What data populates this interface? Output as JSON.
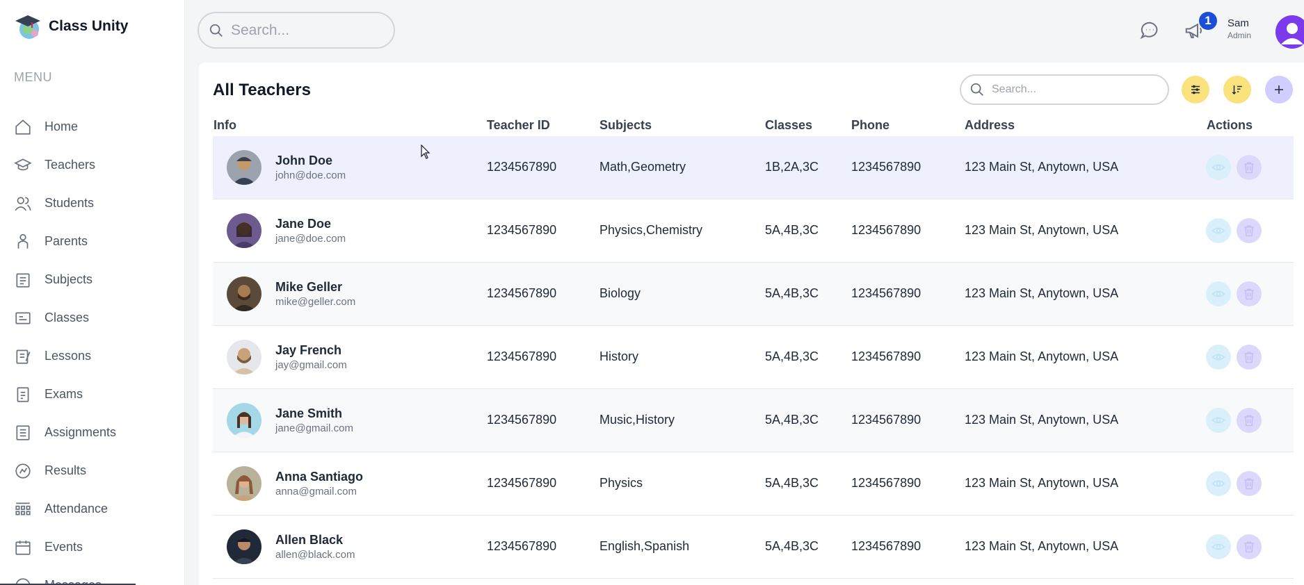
{
  "brand": {
    "name": "Class Unity"
  },
  "sidebar": {
    "menu_title": "MENU",
    "items": [
      {
        "label": "Home",
        "icon": "home-icon"
      },
      {
        "label": "Teachers",
        "icon": "teacher-icon"
      },
      {
        "label": "Students",
        "icon": "students-icon"
      },
      {
        "label": "Parents",
        "icon": "parents-icon"
      },
      {
        "label": "Subjects",
        "icon": "subjects-icon"
      },
      {
        "label": "Classes",
        "icon": "classes-icon"
      },
      {
        "label": "Lessons",
        "icon": "lessons-icon"
      },
      {
        "label": "Exams",
        "icon": "exams-icon"
      },
      {
        "label": "Assignments",
        "icon": "assignments-icon"
      },
      {
        "label": "Results",
        "icon": "results-icon"
      },
      {
        "label": "Attendance",
        "icon": "attendance-icon"
      },
      {
        "label": "Events",
        "icon": "events-icon"
      },
      {
        "label": "Messages",
        "icon": "messages-icon"
      }
    ]
  },
  "topbar": {
    "search_placeholder": "Search...",
    "notification_count": "1",
    "user_name": "Sam",
    "user_role": "Admin"
  },
  "page": {
    "title": "All Teachers",
    "search_placeholder": "Search..."
  },
  "colors": {
    "accent_yellow": "#fae27c",
    "accent_purple": "#cfceff",
    "row_highlight": "#eef0fd",
    "badge_blue": "#1d4ed8"
  },
  "table": {
    "headers": {
      "info": "Info",
      "teacher_id": "Teacher ID",
      "subjects": "Subjects",
      "classes": "Classes",
      "phone": "Phone",
      "address": "Address",
      "actions": "Actions"
    },
    "rows": [
      {
        "name": "John Doe",
        "email": "john@doe.com",
        "teacher_id": "1234567890",
        "subjects": "Math,Geometry",
        "classes": "1B,2A,3C",
        "phone": "1234567890",
        "address": "123 Main St, Anytown, USA"
      },
      {
        "name": "Jane Doe",
        "email": "jane@doe.com",
        "teacher_id": "1234567890",
        "subjects": "Physics,Chemistry",
        "classes": "5A,4B,3C",
        "phone": "1234567890",
        "address": "123 Main St, Anytown, USA"
      },
      {
        "name": "Mike Geller",
        "email": "mike@geller.com",
        "teacher_id": "1234567890",
        "subjects": "Biology",
        "classes": "5A,4B,3C",
        "phone": "1234567890",
        "address": "123 Main St, Anytown, USA"
      },
      {
        "name": "Jay French",
        "email": "jay@gmail.com",
        "teacher_id": "1234567890",
        "subjects": "History",
        "classes": "5A,4B,3C",
        "phone": "1234567890",
        "address": "123 Main St, Anytown, USA"
      },
      {
        "name": "Jane Smith",
        "email": "jane@gmail.com",
        "teacher_id": "1234567890",
        "subjects": "Music,History",
        "classes": "5A,4B,3C",
        "phone": "1234567890",
        "address": "123 Main St, Anytown, USA"
      },
      {
        "name": "Anna Santiago",
        "email": "anna@gmail.com",
        "teacher_id": "1234567890",
        "subjects": "Physics",
        "classes": "5A,4B,3C",
        "phone": "1234567890",
        "address": "123 Main St, Anytown, USA"
      },
      {
        "name": "Allen Black",
        "email": "allen@black.com",
        "teacher_id": "1234567890",
        "subjects": "English,Spanish",
        "classes": "5A,4B,3C",
        "phone": "1234567890",
        "address": "123 Main St, Anytown, USA"
      }
    ]
  }
}
